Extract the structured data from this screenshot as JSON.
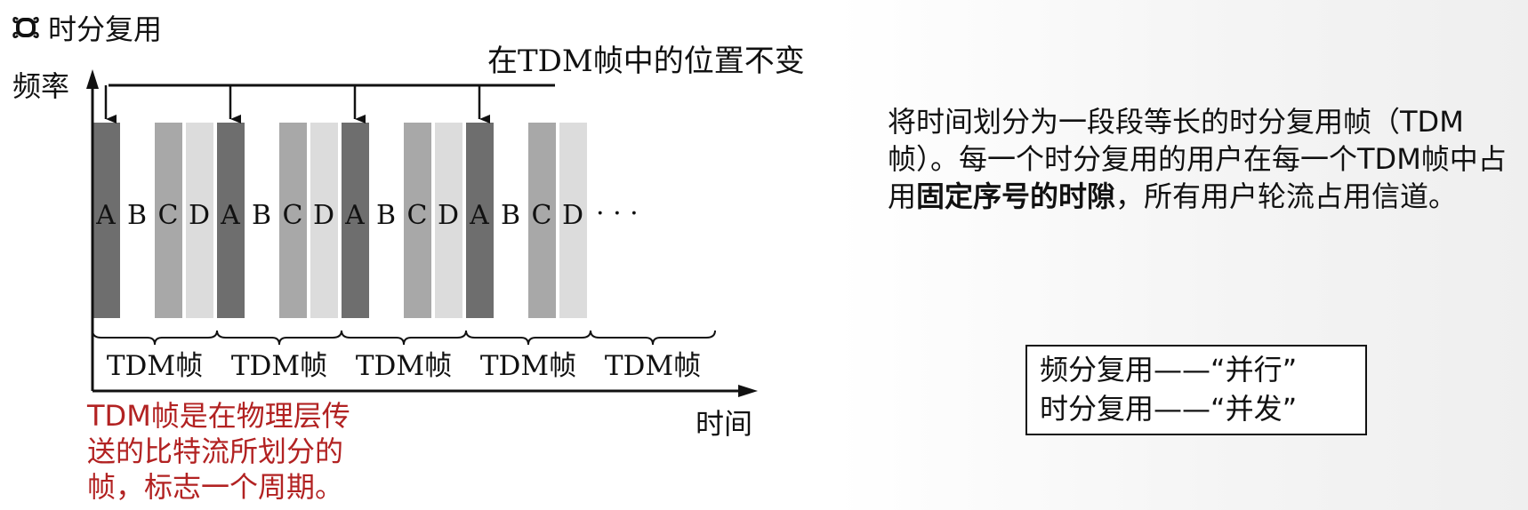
{
  "title": {
    "icon": "quad-loop-bullet-icon",
    "text": "时分复用"
  },
  "diagram": {
    "y_axis_label": "频率",
    "x_axis_label": "时间",
    "position_label": "在TDM帧中的位置不变",
    "continuation": "· · ·",
    "frame_label": "TDM帧",
    "frame_count": 5,
    "slots": [
      {
        "label": "A",
        "color": "#6e6e6e"
      },
      {
        "label": "B",
        "color": "none"
      },
      {
        "label": "C",
        "color": "#a8a8a8"
      },
      {
        "label": "D",
        "color": "#dcdcdc"
      },
      {
        "label": "A",
        "color": "#6e6e6e"
      },
      {
        "label": "B",
        "color": "none"
      },
      {
        "label": "C",
        "color": "#a8a8a8"
      },
      {
        "label": "D",
        "color": "#dcdcdc"
      },
      {
        "label": "A",
        "color": "#6e6e6e"
      },
      {
        "label": "B",
        "color": "none"
      },
      {
        "label": "C",
        "color": "#a8a8a8"
      },
      {
        "label": "D",
        "color": "#dcdcdc"
      },
      {
        "label": "A",
        "color": "#6e6e6e"
      },
      {
        "label": "B",
        "color": "none"
      },
      {
        "label": "C",
        "color": "#a8a8a8"
      },
      {
        "label": "D",
        "color": "#dcdcdc"
      }
    ]
  },
  "red_note": {
    "lines": [
      "TDM帧是在物理层传",
      "送的比特流所划分的",
      "帧，标志一个周期。"
    ],
    "color": "#b22222"
  },
  "description": {
    "part1": "将时间划分为一段段等长的时分复用帧（TDM帧）。每一个时分复用的用户在每一个TDM帧中占用",
    "bold": "固定序号的时隙",
    "part2": "，所有用户轮流占用信道。"
  },
  "comparison": {
    "line1": "频分复用——“并行”",
    "line2": "时分复用——“并发”"
  }
}
